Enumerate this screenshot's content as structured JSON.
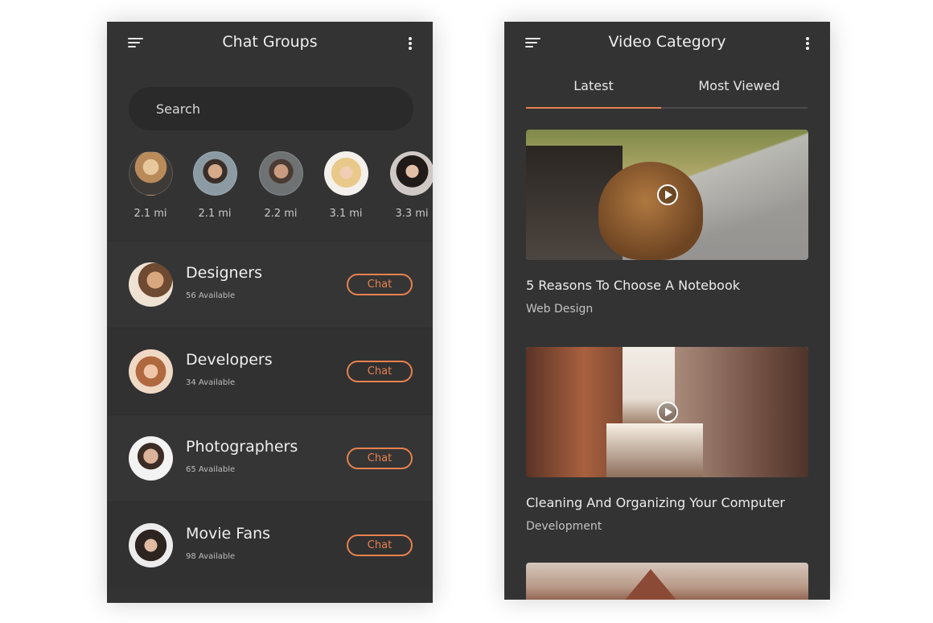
{
  "chat_groups_screen": {
    "title": "Chat Groups",
    "search_placeholder": "Search",
    "nearby": [
      {
        "distance": "2.1 mi"
      },
      {
        "distance": "2.1 mi"
      },
      {
        "distance": "2.2 mi"
      },
      {
        "distance": "3.1 mi"
      },
      {
        "distance": "3.3 mi"
      }
    ],
    "groups": [
      {
        "name": "Designers",
        "available": "56 Available",
        "button": "Chat"
      },
      {
        "name": "Developers",
        "available": "34 Available",
        "button": "Chat"
      },
      {
        "name": "Photographers",
        "available": "65 Available",
        "button": "Chat"
      },
      {
        "name": "Movie Fans",
        "available": "98 Available",
        "button": "Chat"
      }
    ]
  },
  "video_category_screen": {
    "title": "Video Category",
    "tabs": [
      {
        "label": "Latest",
        "active": true
      },
      {
        "label": "Most Viewed",
        "active": false
      }
    ],
    "videos": [
      {
        "title": "5 Reasons To Choose A Notebook",
        "category": "Web Design"
      },
      {
        "title": "Cleaning And Organizing Your Computer",
        "category": "Development"
      }
    ]
  },
  "colors": {
    "background": "#333333",
    "accent": "#e8814f",
    "text": "#e6e6e6"
  },
  "icons": [
    "menu-icon",
    "more-vertical-icon",
    "play-icon"
  ]
}
